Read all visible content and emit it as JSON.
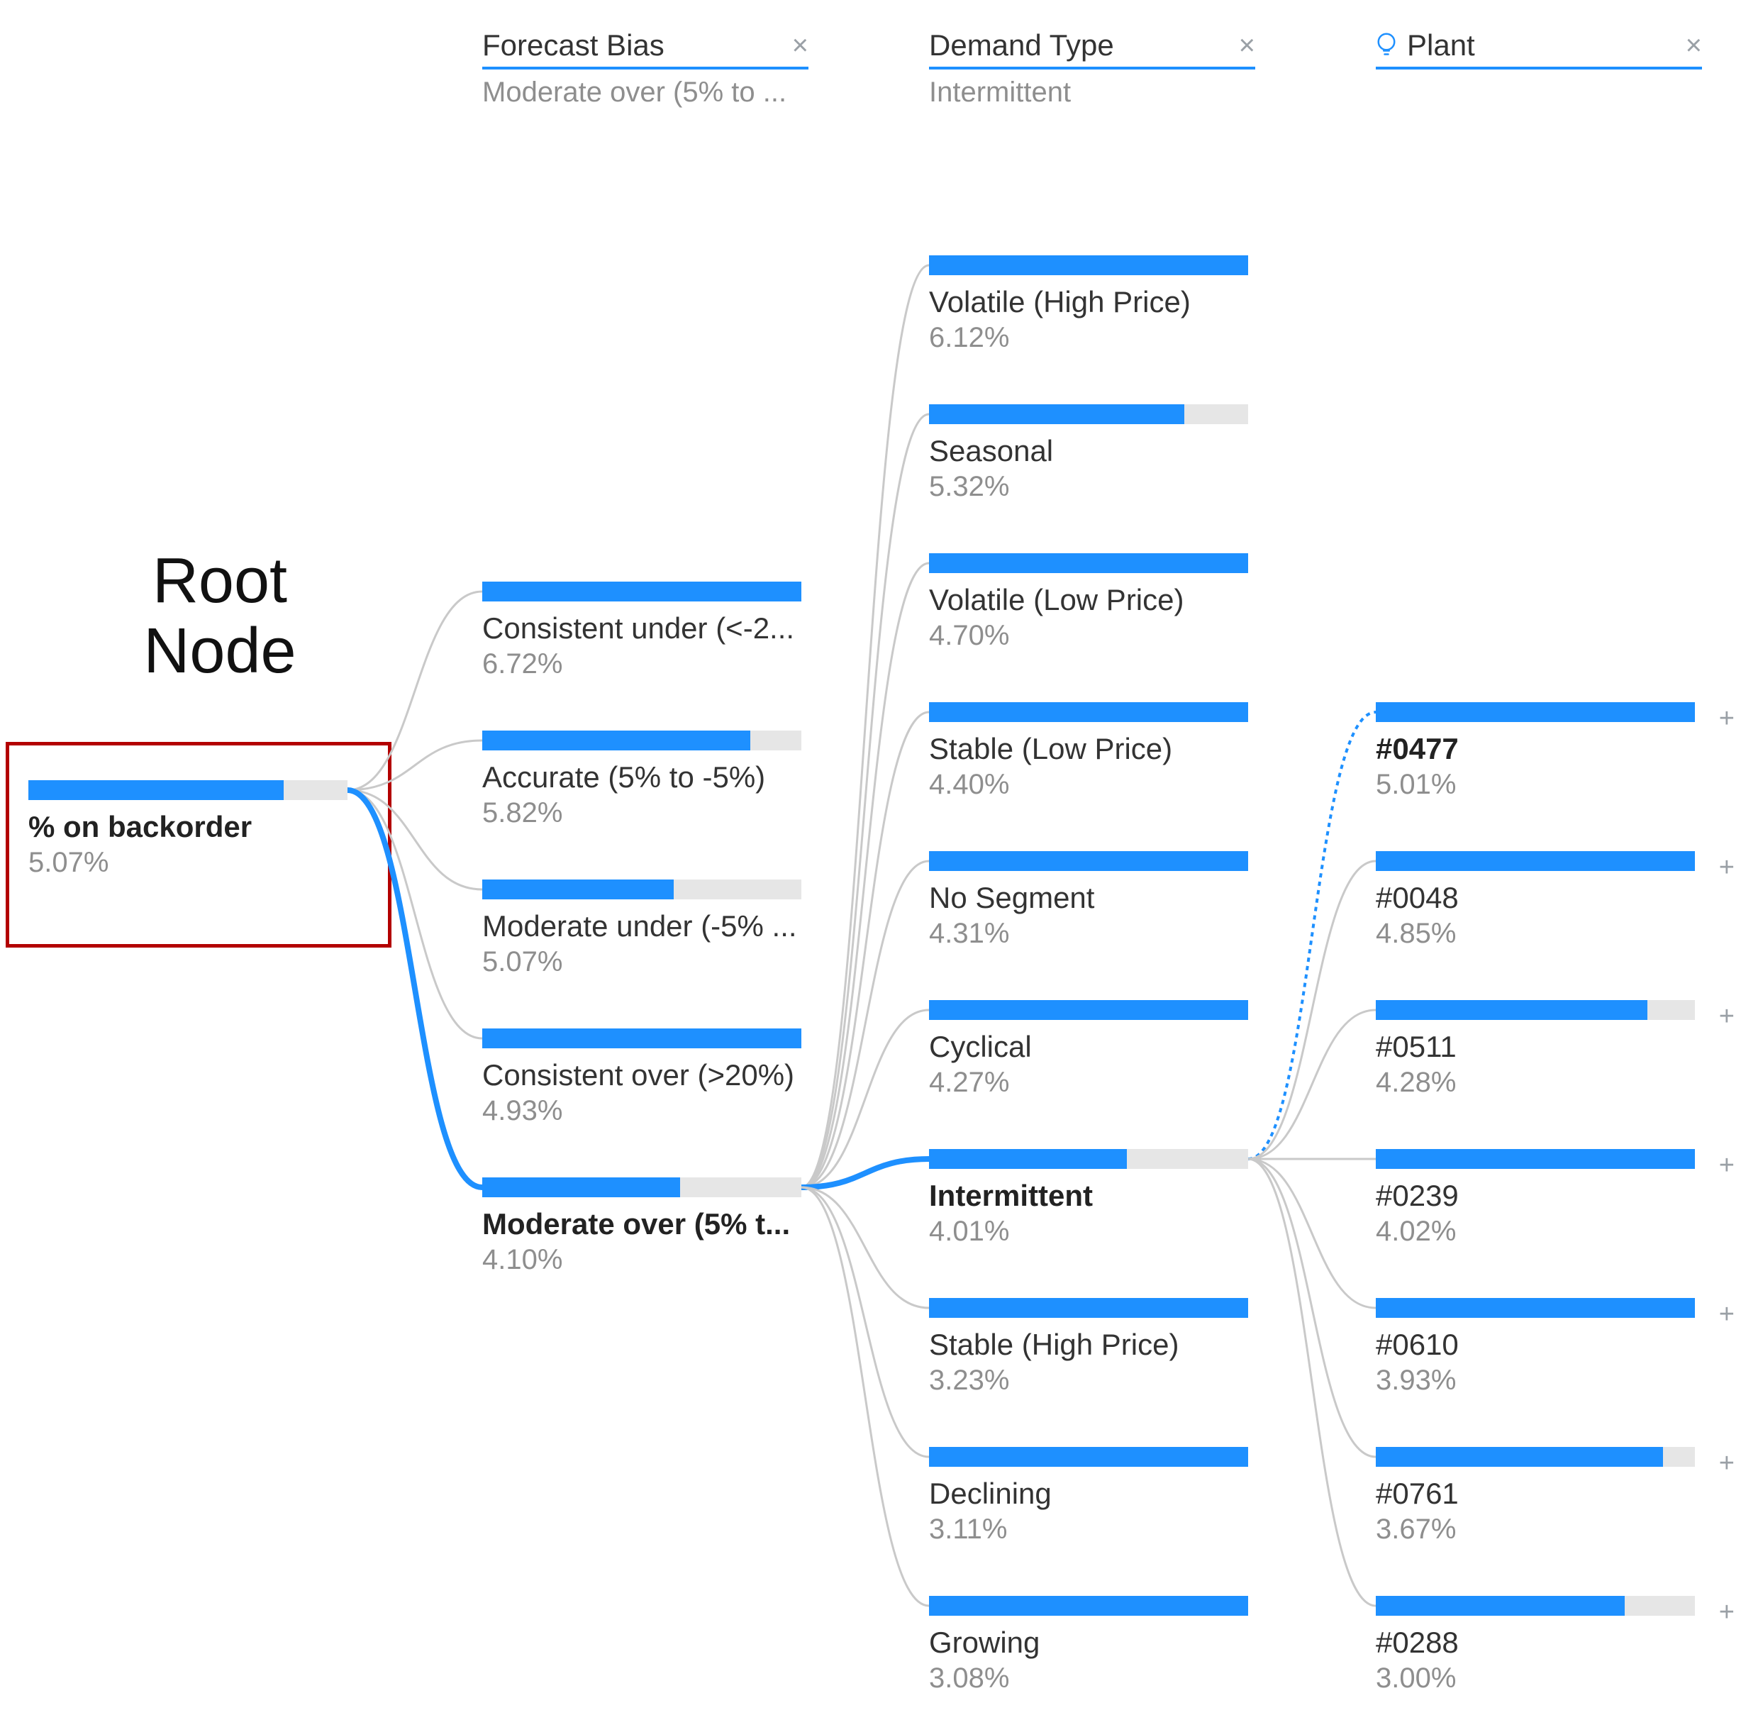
{
  "annotation": {
    "text_line1": "Root",
    "text_line2": "Node"
  },
  "root": {
    "label": "% on backorder",
    "value": "5.07%",
    "fill": 80
  },
  "columns": {
    "forecast_bias": {
      "title": "Forecast Bias",
      "subtitle": "Moderate over (5% to ..."
    },
    "demand_type": {
      "title": "Demand Type",
      "subtitle": "Intermittent"
    },
    "plant": {
      "title": "Plant",
      "subtitle": ""
    }
  },
  "forecast_bias_nodes": [
    {
      "label": "Consistent under (<-2...",
      "value": "6.72%",
      "fill": 100,
      "bold": false
    },
    {
      "label": "Accurate (5% to -5%)",
      "value": "5.82%",
      "fill": 84,
      "bold": false
    },
    {
      "label": "Moderate under (-5% ...",
      "value": "5.07%",
      "fill": 60,
      "bold": false
    },
    {
      "label": "Consistent over (>20%)",
      "value": "4.93%",
      "fill": 100,
      "bold": false
    },
    {
      "label": "Moderate over (5% t...",
      "value": "4.10%",
      "fill": 62,
      "bold": true
    }
  ],
  "demand_type_nodes": [
    {
      "label": "Volatile (High Price)",
      "value": "6.12%",
      "fill": 100,
      "bold": false
    },
    {
      "label": "Seasonal",
      "value": "5.32%",
      "fill": 80,
      "bold": false
    },
    {
      "label": "Volatile (Low Price)",
      "value": "4.70%",
      "fill": 100,
      "bold": false
    },
    {
      "label": "Stable (Low Price)",
      "value": "4.40%",
      "fill": 100,
      "bold": false
    },
    {
      "label": "No Segment",
      "value": "4.31%",
      "fill": 100,
      "bold": false
    },
    {
      "label": "Cyclical",
      "value": "4.27%",
      "fill": 100,
      "bold": false
    },
    {
      "label": "Intermittent",
      "value": "4.01%",
      "fill": 62,
      "bold": true
    },
    {
      "label": "Stable (High Price)",
      "value": "3.23%",
      "fill": 100,
      "bold": false
    },
    {
      "label": "Declining",
      "value": "3.11%",
      "fill": 100,
      "bold": false
    },
    {
      "label": "Growing",
      "value": "3.08%",
      "fill": 100,
      "bold": false
    }
  ],
  "plant_nodes": [
    {
      "label": "#0477",
      "value": "5.01%",
      "fill": 100,
      "bold": true
    },
    {
      "label": "#0048",
      "value": "4.85%",
      "fill": 100,
      "bold": false
    },
    {
      "label": "#0511",
      "value": "4.28%",
      "fill": 85,
      "bold": false
    },
    {
      "label": "#0239",
      "value": "4.02%",
      "fill": 100,
      "bold": false
    },
    {
      "label": "#0610",
      "value": "3.93%",
      "fill": 100,
      "bold": false
    },
    {
      "label": "#0761",
      "value": "3.67%",
      "fill": 90,
      "bold": false
    },
    {
      "label": "#0288",
      "value": "3.00%",
      "fill": 78,
      "bold": false
    }
  ],
  "icons": {
    "close_glyph": "×",
    "plus_glyph": "+"
  },
  "colors": {
    "accent": "#1e90ff",
    "track": "#e6e6e6",
    "muted": "#8e8e8e",
    "highlight": "#b30000"
  }
}
